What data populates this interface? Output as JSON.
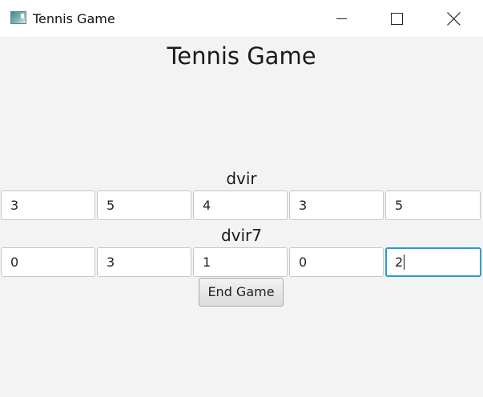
{
  "window": {
    "title": "Tennis Game",
    "icon": "app-window-icon",
    "controls": [
      "minimize-icon",
      "maximize-icon",
      "close-icon"
    ]
  },
  "main": {
    "heading": "Tennis Game",
    "players": [
      {
        "name": "dvir",
        "scores": [
          "3",
          "5",
          "4",
          "3",
          "5"
        ]
      },
      {
        "name": "dvir7",
        "scores": [
          "0",
          "3",
          "1",
          "0",
          "2"
        ]
      }
    ],
    "end_button_label": "End Game"
  },
  "colors": {
    "background": "#f3f3f3",
    "titlebar": "#ffffff",
    "focus_border": "#2b9bd6",
    "field_border": "#c7c7c7"
  }
}
